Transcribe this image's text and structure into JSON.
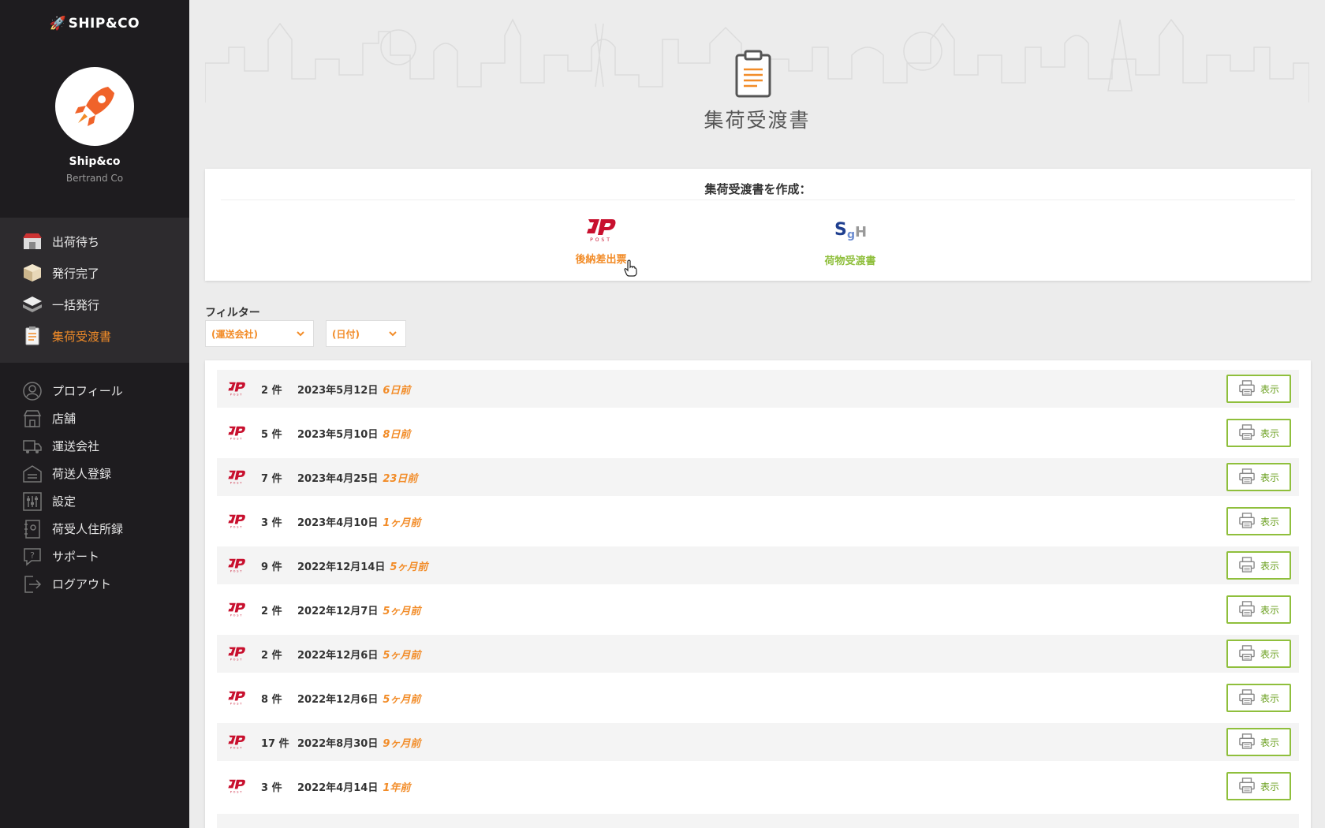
{
  "sidebar": {
    "brand": "SHIP&CO",
    "company_name": "Ship&co",
    "company_sub": "Bertrand Co",
    "primary": [
      {
        "label": "出荷待ち",
        "icon": "store-icon",
        "active": false
      },
      {
        "label": "発行完了",
        "icon": "box-icon",
        "active": false
      },
      {
        "label": "一括発行",
        "icon": "stack-icon",
        "active": false
      },
      {
        "label": "集荷受渡書",
        "icon": "clipboard-icon",
        "active": true
      }
    ],
    "secondary": [
      {
        "label": "プロフィール",
        "icon": "user-icon"
      },
      {
        "label": "店舗",
        "icon": "shop-icon"
      },
      {
        "label": "運送会社",
        "icon": "truck-icon"
      },
      {
        "label": "荷送人登録",
        "icon": "warehouse-icon"
      },
      {
        "label": "設定",
        "icon": "sliders-icon"
      },
      {
        "label": "荷受人住所録",
        "icon": "address-book-icon"
      },
      {
        "label": "サポート",
        "icon": "help-icon"
      },
      {
        "label": "ログアウト",
        "icon": "logout-icon"
      }
    ]
  },
  "header": {
    "title": "集荷受渡書"
  },
  "create": {
    "heading": "集荷受渡書を作成：",
    "options": [
      {
        "label": "後納差出票",
        "icon": "japan-post-icon"
      },
      {
        "label": "荷物受渡書",
        "icon": "sagawa-icon"
      }
    ]
  },
  "filter": {
    "label": "フィルター",
    "carrier_select": "(運送会社)",
    "date_select": "(日付)"
  },
  "manifests": [
    {
      "count": "2 件",
      "date": "2023年5月12日",
      "ago": "6日前",
      "button": "表示"
    },
    {
      "count": "5 件",
      "date": "2023年5月10日",
      "ago": "8日前",
      "button": "表示"
    },
    {
      "count": "7 件",
      "date": "2023年4月25日",
      "ago": "23日前",
      "button": "表示"
    },
    {
      "count": "3 件",
      "date": "2023年4月10日",
      "ago": "1ヶ月前",
      "button": "表示"
    },
    {
      "count": "9 件",
      "date": "2022年12月14日",
      "ago": "5ヶ月前",
      "button": "表示"
    },
    {
      "count": "2 件",
      "date": "2022年12月7日",
      "ago": "5ヶ月前",
      "button": "表示"
    },
    {
      "count": "2 件",
      "date": "2022年12月6日",
      "ago": "5ヶ月前",
      "button": "表示"
    },
    {
      "count": "8 件",
      "date": "2022年12月6日",
      "ago": "5ヶ月前",
      "button": "表示"
    },
    {
      "count": "17 件",
      "date": "2022年8月30日",
      "ago": "9ヶ月前",
      "button": "表示"
    },
    {
      "count": "3 件",
      "date": "2022年4月14日",
      "ago": "1年前",
      "button": "表示"
    }
  ],
  "colors": {
    "accent": "#f28c28",
    "sidebar_bg": "#1e1c1f",
    "button_green": "#8fbf3c",
    "jp_red": "#c8102e"
  }
}
